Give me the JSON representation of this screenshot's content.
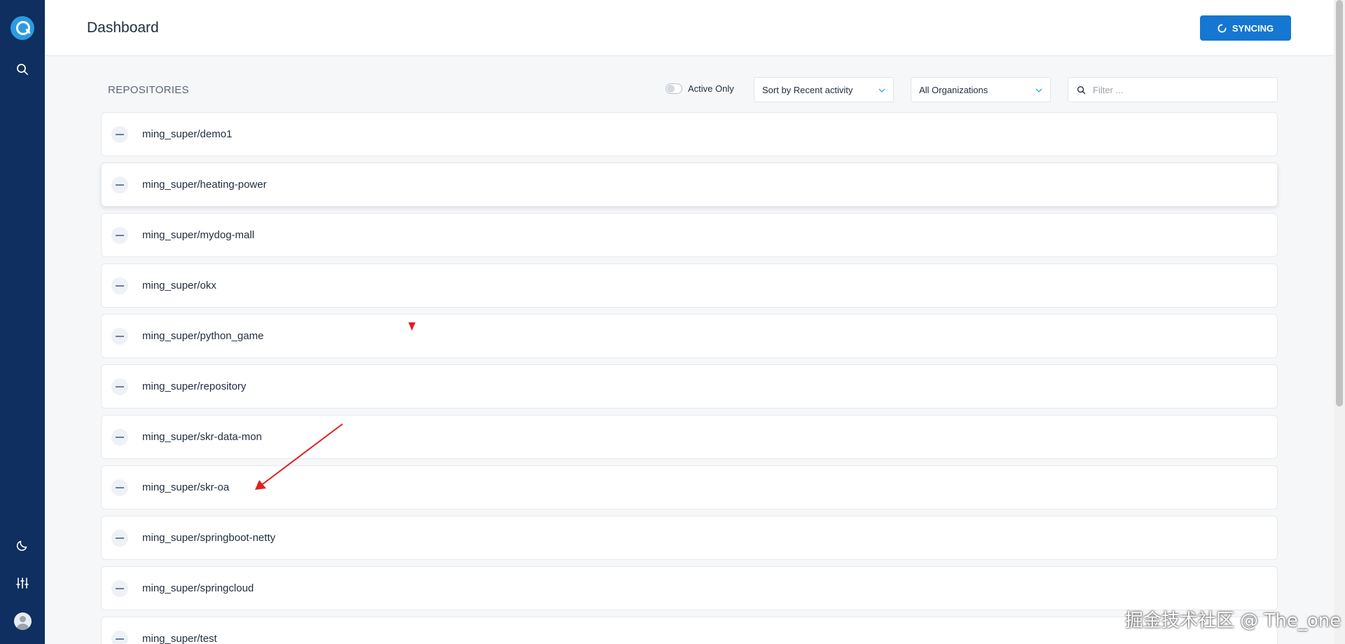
{
  "sidebar": {
    "logo": "app-logo",
    "icons": [
      "search-icon",
      "moon-icon",
      "sliders-icon"
    ],
    "avatar": "user-avatar"
  },
  "header": {
    "title": "Dashboard",
    "sync_label": "SYNCING",
    "sync_icon": "spinner-icon",
    "accent": "#1577d1"
  },
  "toolbar": {
    "section_label": "REPOSITORIES",
    "active_only_label": "Active Only",
    "active_only": false,
    "sort_value": "Sort by Recent activity",
    "org_value": "All Organizations",
    "filter_placeholder": "Filter ...",
    "filter_value": ""
  },
  "repos": [
    {
      "name": "ming_super/demo1"
    },
    {
      "name": "ming_super/heating-power"
    },
    {
      "name": "ming_super/mydog-mall"
    },
    {
      "name": "ming_super/okx"
    },
    {
      "name": "ming_super/python_game"
    },
    {
      "name": "ming_super/repository"
    },
    {
      "name": "ming_super/skr-data-mon"
    },
    {
      "name": "ming_super/skr-oa"
    },
    {
      "name": "ming_super/springboot-netty"
    },
    {
      "name": "ming_super/springcloud"
    },
    {
      "name": "ming_super/test"
    }
  ],
  "watermark": "掘金技术社区 @ The_one",
  "colors": {
    "sidebar": "#0e2f5f",
    "annotation": "#e02020"
  }
}
